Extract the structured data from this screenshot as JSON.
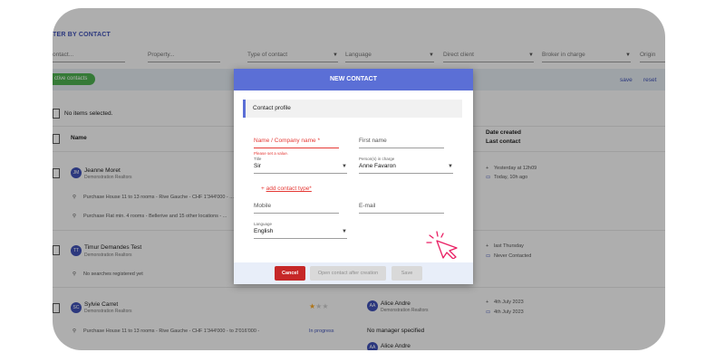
{
  "filters": {
    "title": "TER BY CONTACT",
    "contact": "ontact...",
    "property": "Property...",
    "type": "Type of contact",
    "language": "Language",
    "direct_client": "Direct client",
    "broker": "Broker in charge",
    "origin": "Origin"
  },
  "toolbar": {
    "chip": "ctive contacts",
    "save": "save",
    "reset": "reset"
  },
  "list": {
    "no_selection": "No items selected.",
    "col_name": "Name",
    "col_date_1": "Date created",
    "col_date_2": "Last contact",
    "contacts": [
      {
        "initials": "JM",
        "name": "Jeanne Moret",
        "org": "Demonstration Realtors",
        "date1": "Yesterday at 12h09",
        "date2": "Today, 10h ago",
        "searches": [
          "Purchase House 11 to 13 rooms - Rive Gauche - CHF 1'344'000 - ...",
          "Purchase Flat min. 4 rooms - Bellerive and 15 other locations - ..."
        ]
      },
      {
        "initials": "TT",
        "name": "Timur Demandes Test",
        "org": "Demonstration Realtors",
        "date1": "last Thursday",
        "date2": "Never Contacted",
        "searches": [
          "No searches registered yet"
        ]
      },
      {
        "initials": "SC",
        "name": "Sylvie Carret",
        "org": "Demonstration Realtors",
        "broker_initials": "AA",
        "broker": "Alice Andre",
        "broker_org": "Demonstration Realtors",
        "date1": "4th July 2023",
        "date2": "4th July 2023",
        "searches": [
          "Purchase House 11 to 13 rooms - Rive Gauche - CHF 1'344'000 - to 2'016'000 -"
        ],
        "status": "In progress",
        "manager": "No manager specified",
        "next_broker": "Alice Andre"
      }
    ]
  },
  "dialog": {
    "title": "NEW CONTACT",
    "section": "Contact profile",
    "name_placeholder": "Name / Company name *",
    "name_error": "Please set a value.",
    "first_name": "First name",
    "title_label": "Title",
    "title_value": "Sir",
    "persons_label": "Person(s) in charge",
    "persons_value": "Anne Favaron",
    "add_type": "add contact type*",
    "mobile": "Mobile",
    "email": "E-mail",
    "language_label": "Language",
    "language_value": "English",
    "cancel": "Cancel",
    "open_after": "Open contact after creation",
    "save": "Save"
  },
  "colors": {
    "accent": "#5b6fd6",
    "error": "#e53935",
    "cancel": "#c62828",
    "chip": "#4caf50",
    "cursor": "#e91e63"
  },
  "icons": {
    "cursor": "pointer-click-icon",
    "star": "star-icon",
    "search": "search-icon",
    "plus": "plus-icon",
    "chat": "chat-icon"
  }
}
